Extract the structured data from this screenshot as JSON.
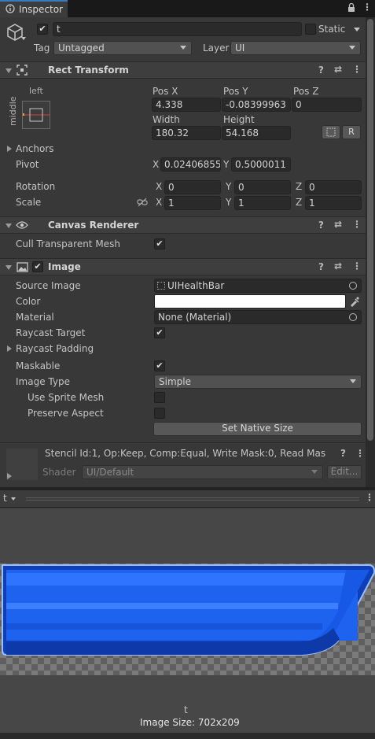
{
  "tab": {
    "title": "Inspector"
  },
  "object": {
    "name": "t",
    "static_label": "Static",
    "tag_label": "Tag",
    "tag_value": "Untagged",
    "layer_label": "Layer",
    "layer_value": "UI"
  },
  "rect_transform": {
    "title": "Rect Transform",
    "anchor_h": "left",
    "anchor_v": "middle",
    "pos_x_label": "Pos X",
    "pos_y_label": "Pos Y",
    "pos_z_label": "Pos Z",
    "pos_x": "4.338",
    "pos_y": "-0.08399963",
    "pos_z": "0",
    "width_label": "Width",
    "height_label": "Height",
    "width": "180.32",
    "height": "54.168",
    "r_button": "R",
    "anchors_label": "Anchors",
    "pivot_label": "Pivot",
    "pivot_x": "0.02406855",
    "pivot_y": "0.5000011",
    "rotation_label": "Rotation",
    "rot_x": "0",
    "rot_y": "0",
    "rot_z": "0",
    "scale_label": "Scale",
    "scale_x": "1",
    "scale_y": "1",
    "scale_z": "1",
    "x": "X",
    "y": "Y",
    "z": "Z"
  },
  "canvas_renderer": {
    "title": "Canvas Renderer",
    "cull_label": "Cull Transparent Mesh",
    "cull_checked": "✔"
  },
  "image": {
    "title": "Image",
    "source_label": "Source Image",
    "source_value": "UIHealthBar",
    "color_label": "Color",
    "color_value": "#ffffff",
    "material_label": "Material",
    "material_value": "None (Material)",
    "raycast_target_label": "Raycast Target",
    "raycast_target_checked": "✔",
    "raycast_padding_label": "Raycast Padding",
    "maskable_label": "Maskable",
    "maskable_checked": "✔",
    "image_type_label": "Image Type",
    "image_type_value": "Simple",
    "use_sprite_mesh_label": "Use Sprite Mesh",
    "preserve_aspect_label": "Preserve Aspect",
    "set_native_size": "Set Native Size"
  },
  "material_block": {
    "stencil_text": "Stencil Id:1, Op:Keep, Comp:Equal, Write Mask:0, Read Mas",
    "shader_label": "Shader",
    "shader_value": "UI/Default",
    "edit_button": "Edit..."
  },
  "preview": {
    "dropdown": "t",
    "name": "t",
    "image_size": "Image Size: 702x209"
  },
  "colors": {
    "accent": "#3a79bb",
    "bar_blue": "#1a5ee8",
    "bar_highlight": "#4a8cff"
  },
  "icons": [
    "gameobject-cube-icon",
    "rect-transform-icon",
    "eye-icon",
    "image-icon",
    "help-icon",
    "preset-icon",
    "kebab-menu-icon",
    "link-icon",
    "color-picker-icon",
    "object-picker-icon",
    "lock-icon"
  ]
}
